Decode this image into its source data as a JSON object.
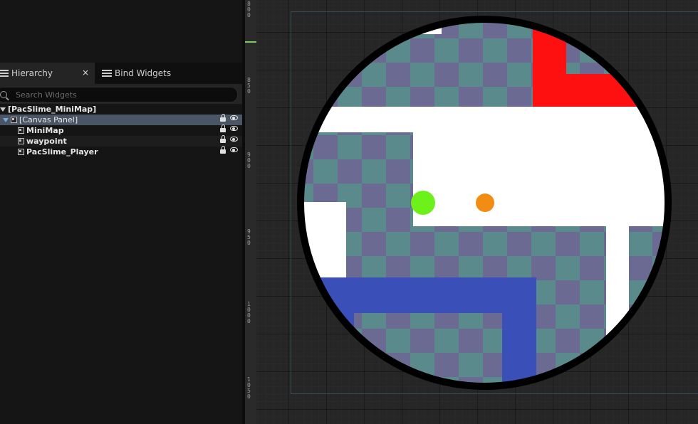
{
  "hierarchy_panel": {
    "tabs": [
      {
        "label": "Hierarchy",
        "icon": "hierarchy-icon",
        "closable": true
      },
      {
        "label": "Bind Widgets",
        "icon": "bind-widgets-icon"
      }
    ],
    "close_glyph": "×",
    "search": {
      "placeholder": "Search Widgets",
      "value": ""
    },
    "tree": [
      {
        "label": "[PacSlime_MiniMap]"
      },
      {
        "label": "[Canvas Panel]",
        "selected": true,
        "locked": true,
        "visible": true
      },
      {
        "label": "MiniMap",
        "locked": true,
        "visible": true
      },
      {
        "label": "waypoint",
        "locked": true,
        "visible": true
      },
      {
        "label": "PacSlime_Player",
        "locked": true,
        "visible": true
      }
    ]
  },
  "designer": {
    "ruler_labels": [
      "800",
      "850",
      "900",
      "950",
      "1000",
      "1050"
    ],
    "minimap": {
      "colors": {
        "border": "#000000",
        "floor_checker_a": "#5a8a8c",
        "floor_checker_b": "#6b6a92",
        "walls": "#ffffff",
        "red_zone": "#ff1010",
        "blue_zone": "#3a4fb8",
        "player_dot": "#6cf21a",
        "waypoint_dot": "#f28c12"
      }
    }
  }
}
